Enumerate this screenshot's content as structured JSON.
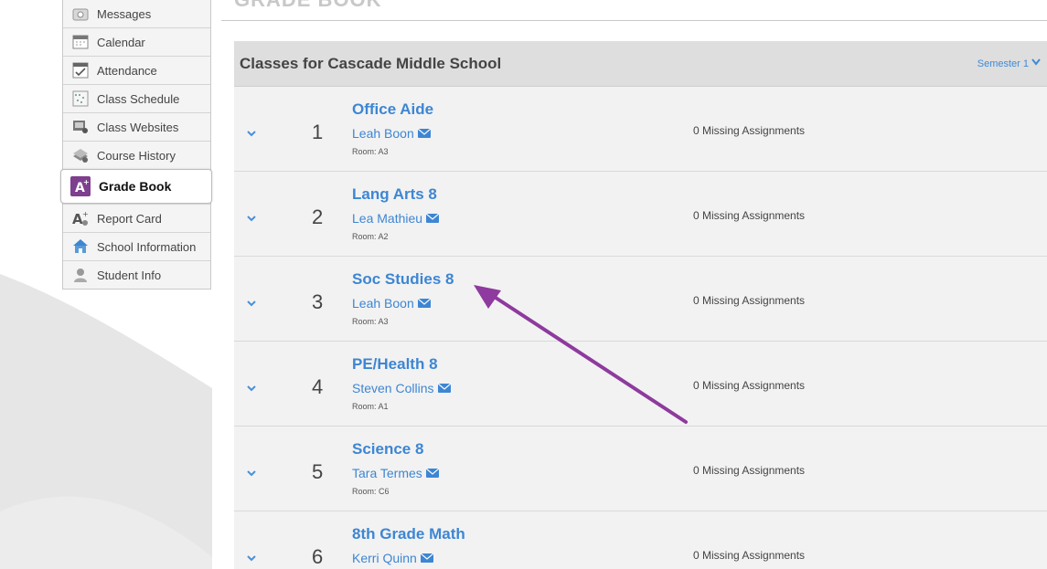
{
  "sidebar": {
    "items": [
      {
        "label": "Messages",
        "icon": "messages-icon"
      },
      {
        "label": "Calendar",
        "icon": "calendar-icon"
      },
      {
        "label": "Attendance",
        "icon": "attendance-icon"
      },
      {
        "label": "Class Schedule",
        "icon": "class-schedule-icon"
      },
      {
        "label": "Class Websites",
        "icon": "class-websites-icon"
      },
      {
        "label": "Course History",
        "icon": "course-history-icon"
      },
      {
        "label": "Grade Book",
        "icon": "grade-book-icon",
        "active": true
      },
      {
        "label": "Report Card",
        "icon": "report-card-icon"
      },
      {
        "label": "School Information",
        "icon": "school-information-icon"
      },
      {
        "label": "Student Info",
        "icon": "student-info-icon"
      }
    ]
  },
  "main": {
    "page_title": "GRADE BOOK",
    "panel_title": "Classes for Cascade Middle School",
    "semester_label": "Semester 1",
    "classes": [
      {
        "number": "1",
        "course": "Office Aide",
        "teacher": "Leah Boon",
        "room": "Room: A3",
        "missing": "0 Missing Assignments"
      },
      {
        "number": "2",
        "course": "Lang Arts 8",
        "teacher": "Lea Mathieu",
        "room": "Room: A2",
        "missing": "0 Missing Assignments"
      },
      {
        "number": "3",
        "course": "Soc Studies 8",
        "teacher": "Leah Boon",
        "room": "Room: A3",
        "missing": "0 Missing Assignments"
      },
      {
        "number": "4",
        "course": "PE/Health 8",
        "teacher": "Steven Collins",
        "room": "Room: A1",
        "missing": "0 Missing Assignments"
      },
      {
        "number": "5",
        "course": "Science 8",
        "teacher": "Tara Termes",
        "room": "Room: C6",
        "missing": "0 Missing Assignments"
      },
      {
        "number": "6",
        "course": "8th Grade Math",
        "teacher": "Kerri Quinn",
        "room": "",
        "missing": "0 Missing Assignments"
      }
    ]
  },
  "colors": {
    "link": "#3d86d3",
    "annotation_arrow": "#8e3a9e",
    "header_bg": "#dedede",
    "row_bg": "#f2f2f2"
  }
}
